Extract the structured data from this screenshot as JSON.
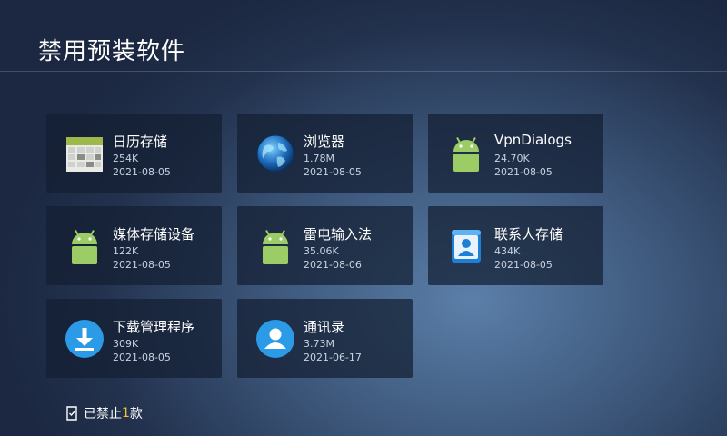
{
  "page": {
    "title": "禁用预装软件"
  },
  "apps": [
    {
      "name": "日历存储",
      "size": "254K",
      "date": "2021-08-05",
      "icon": "calendar-icon"
    },
    {
      "name": "浏览器",
      "size": "1.78M",
      "date": "2021-08-05",
      "icon": "globe-icon"
    },
    {
      "name": "VpnDialogs",
      "size": "24.70K",
      "date": "2021-08-05",
      "icon": "android-icon"
    },
    {
      "name": "媒体存储设备",
      "size": "122K",
      "date": "2021-08-05",
      "icon": "android-icon"
    },
    {
      "name": "雷电输入法",
      "size": "35.06K",
      "date": "2021-08-06",
      "icon": "android-icon"
    },
    {
      "name": "联系人存储",
      "size": "434K",
      "date": "2021-08-05",
      "icon": "contacts-storage-icon"
    },
    {
      "name": "下载管理程序",
      "size": "309K",
      "date": "2021-08-05",
      "icon": "download-icon"
    },
    {
      "name": "通讯录",
      "size": "3.73M",
      "date": "2021-06-17",
      "icon": "contacts-icon"
    }
  ],
  "footer": {
    "prefix": "已禁止",
    "count": "1",
    "suffix": "款",
    "icon": "disabled-app-icon"
  },
  "colors": {
    "android": "#9ccc65",
    "download": "#2b9be8",
    "contacts": "#2b9be8",
    "count_highlight": "#f2c230"
  }
}
